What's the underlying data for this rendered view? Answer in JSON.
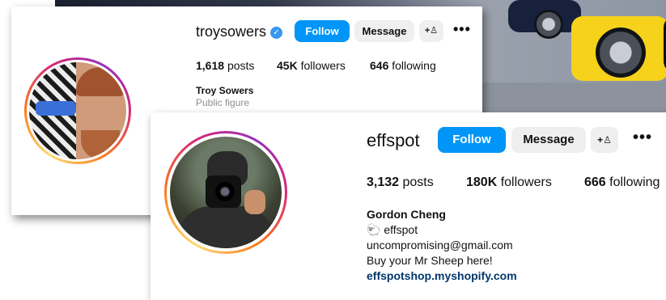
{
  "profile_back": {
    "username": "troysowers",
    "verified_icon": "verified-badge-icon",
    "follow_label": "Follow",
    "message_label": "Message",
    "add_person_icon": "+R",
    "more_icon": "•••",
    "stats": {
      "posts_count": "1,618",
      "posts_label": "posts",
      "followers_count": "45K",
      "followers_label": "followers",
      "following_count": "646",
      "following_label": "following"
    },
    "bio": {
      "name": "Troy Sowers",
      "category": "Public figure"
    }
  },
  "profile_front": {
    "username": "effspot",
    "follow_label": "Follow",
    "message_label": "Message",
    "more_icon": "•••",
    "stats": {
      "posts_count": "3,132",
      "posts_label": "posts",
      "followers_count": "180K",
      "followers_label": "followers",
      "following_count": "666",
      "following_label": "following"
    },
    "bio": {
      "name": "Gordon Cheng",
      "handle_line": "effspot",
      "handle_icon": "sheep-emoji-icon",
      "email": "uncompromising@gmail.com",
      "tagline": "Buy your Mr Sheep here!",
      "link": "effspotshop.myshopify.com"
    }
  },
  "colors": {
    "follow_blue": "#0095f6",
    "button_grey": "#efefef",
    "link_blue": "#00376b",
    "verified_blue": "#3897f0"
  }
}
